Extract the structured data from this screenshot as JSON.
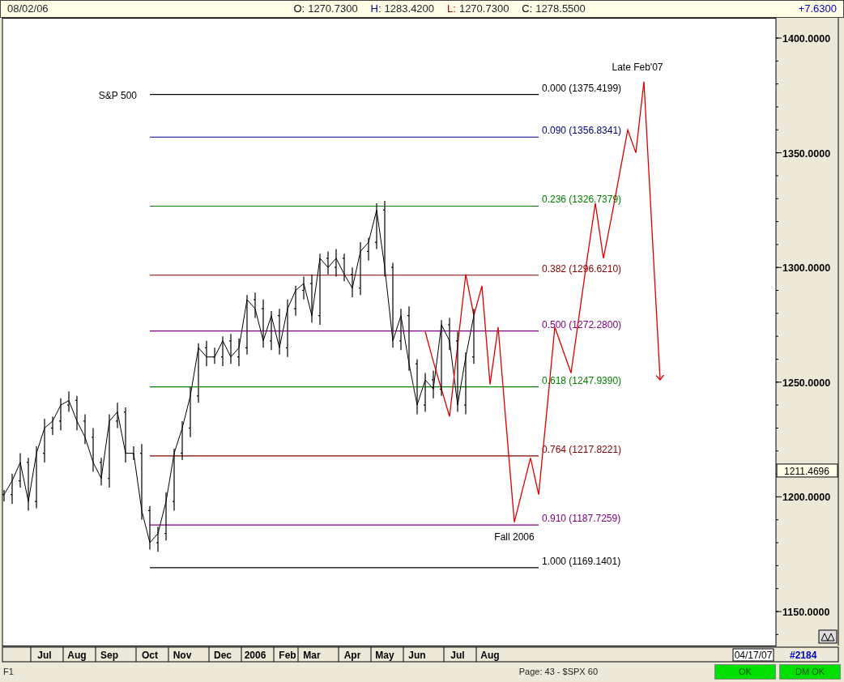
{
  "header": {
    "date": "08/02/06",
    "fields": [
      {
        "label": "O:",
        "value": "1270.7300",
        "color": "#000000"
      },
      {
        "label": "H:",
        "value": "1283.4200",
        "color": "#000080"
      },
      {
        "label": "L:",
        "value": "1270.7300",
        "color": "#c00000"
      },
      {
        "label": "C:",
        "value": "1278.5500",
        "color": "#000000"
      }
    ],
    "change": "+7.6300"
  },
  "chart": {
    "chart_data": {
      "type": "line",
      "title": "S&P 500",
      "ylim": [
        1135.17,
        1408.83
      ],
      "categories": [
        null,
        null,
        null,
        null,
        null,
        "Jul",
        null,
        null,
        null,
        "Aug",
        null,
        null,
        null,
        "Sep",
        null,
        null,
        null,
        null,
        "Oct",
        null,
        null,
        null,
        "Nov",
        null,
        null,
        null,
        null,
        "Dec",
        null,
        null,
        null,
        "2006",
        null,
        null,
        null,
        "Feb",
        null,
        null,
        "Mar",
        null,
        null,
        null,
        null,
        "Apr",
        null,
        null,
        null,
        "May",
        null,
        null,
        null,
        "Jun",
        null,
        null,
        null,
        null,
        "Jul",
        null,
        null,
        null,
        "Aug",
        null,
        null,
        null,
        null,
        null,
        null,
        null,
        null,
        null,
        null,
        null,
        null,
        null,
        null,
        null,
        null,
        null,
        null,
        null,
        null,
        null,
        null,
        null,
        null,
        null,
        null,
        null,
        null,
        null,
        null,
        null,
        null,
        null,
        null,
        null
      ],
      "yticks": [
        {
          "value": 1400,
          "label": "1400.0000"
        },
        {
          "value": 1350,
          "label": "1350.0000"
        },
        {
          "value": 1300,
          "label": "1300.0000"
        },
        {
          "value": 1250,
          "label": "1250.0000"
        },
        {
          "value": 1200,
          "label": "1200.0000"
        },
        {
          "value": 1150,
          "label": "1150.0000"
        }
      ],
      "series": [
        {
          "color": "#000000",
          "values": [
            1201,
            1207,
            1215,
            1198,
            1219,
            1230,
            1233,
            1240,
            1242,
            1233,
            1226,
            1215,
            1208,
            1233,
            1237,
            1219,
            1219,
            1194,
            1180,
            1184,
            1198,
            1219,
            1230,
            1244,
            1265,
            1261,
            1261,
            1268,
            1261,
            1265,
            1286,
            1282,
            1268,
            1279,
            1265,
            1282,
            1290,
            1293,
            1279,
            1304,
            1300,
            1304,
            1297,
            1291,
            1307,
            1311,
            1325,
            1300,
            1268,
            1279,
            1258,
            1240,
            1251,
            1247,
            1275,
            1268,
            1240,
            1261,
            1279,
            null,
            null,
            null,
            null,
            null,
            null,
            null,
            null,
            null,
            null,
            null,
            null,
            null,
            null,
            null,
            null,
            null,
            null,
            null,
            null,
            null,
            null,
            null,
            null,
            null,
            null,
            null,
            null,
            null,
            null,
            null,
            null,
            null,
            null,
            null,
            null,
            null
          ]
        },
        {
          "color": "#e00000",
          "values": [
            null,
            null,
            null,
            null,
            null,
            null,
            null,
            null,
            null,
            null,
            null,
            null,
            null,
            null,
            null,
            null,
            null,
            null,
            null,
            null,
            null,
            null,
            null,
            null,
            null,
            null,
            null,
            null,
            null,
            null,
            null,
            null,
            null,
            null,
            null,
            null,
            null,
            null,
            null,
            null,
            null,
            null,
            null,
            null,
            null,
            null,
            null,
            null,
            null,
            null,
            null,
            null,
            1272,
            1259,
            1247,
            1235,
            1266,
            1297,
            1279,
            1292,
            1249,
            1274,
            1231,
            1189,
            1203,
            1217,
            1201,
            1237,
            1274,
            1264,
            1254,
            1279,
            1304,
            1328,
            1304,
            1322,
            1341,
            1360,
            1350,
            1381,
            1316,
            1251,
            null,
            null,
            null,
            null,
            null,
            null,
            null,
            null,
            null,
            null,
            null,
            null,
            null,
            null
          ]
        }
      ],
      "ref_lines": [
        {
          "axis": "y",
          "value": 1375.4199,
          "label": "0.000 (1375.4199)",
          "color": "#000000"
        },
        {
          "axis": "y",
          "value": 1356.8341,
          "label": "0.090 (1356.8341)",
          "color": "#000080"
        },
        {
          "axis": "y",
          "value": 1326.7379,
          "label": "0.236 (1326.7379)",
          "color": "#008000"
        },
        {
          "axis": "y",
          "value": 1296.621,
          "label": "0.382 (1296.6210)",
          "color": "#800000"
        },
        {
          "axis": "y",
          "value": 1272.28,
          "label": "0.500 (1272.2800)",
          "color": "#800080"
        },
        {
          "axis": "y",
          "value": 1247.939,
          "label": "0.618 (1247.9390)",
          "color": "#008000"
        },
        {
          "axis": "y",
          "value": 1217.8221,
          "label": "0.764 (1217.8221)",
          "color": "#800000"
        },
        {
          "axis": "y",
          "value": 1187.7259,
          "label": "0.910 (1187.7259)",
          "color": "#800080"
        },
        {
          "axis": "y",
          "value": 1169.1401,
          "label": "1.000 (1169.1401)",
          "color": "#000000"
        }
      ],
      "annotations": [
        "Late Feb'07",
        "Fall 2006"
      ]
    },
    "last_price": "1211.4696",
    "date_box": "04/17/07",
    "bar_count": "#2184"
  },
  "status_bar": {
    "key": "F1",
    "page": "Page: 43 - $SPX 60",
    "indicators": [
      {
        "label": "OK"
      },
      {
        "label": "DM OK"
      }
    ]
  }
}
